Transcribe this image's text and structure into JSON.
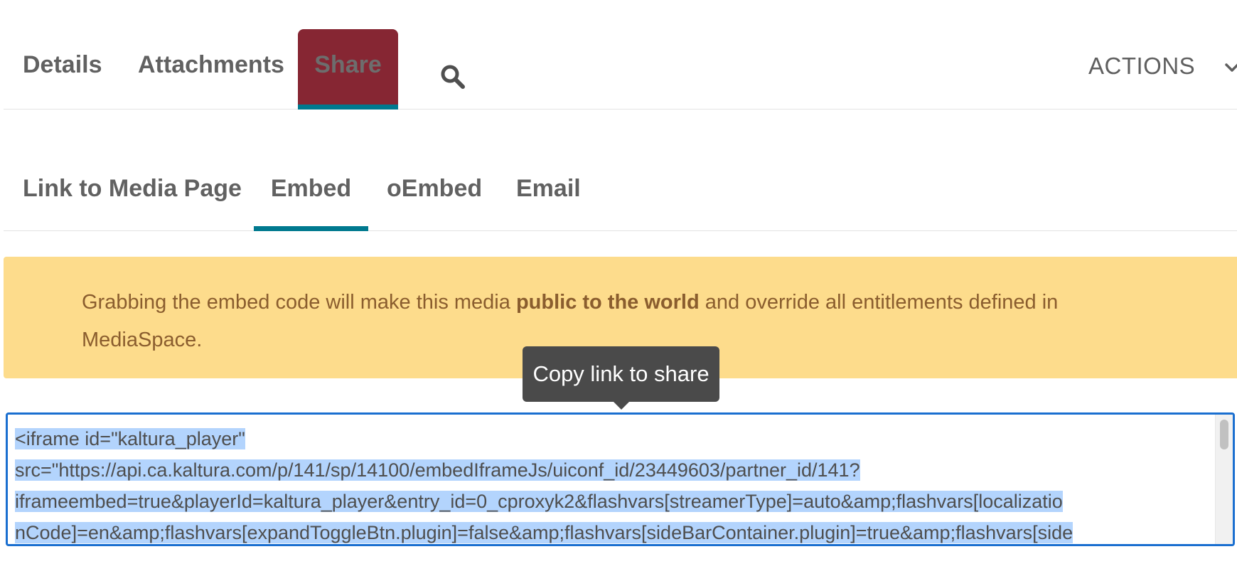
{
  "top_tabs": {
    "details": "Details",
    "attachments": "Attachments",
    "share": "Share",
    "search_icon": "search-icon",
    "actions": "ACTIONS",
    "actions_icon": "chevron-down-icon",
    "active": "Share"
  },
  "share_tabs": {
    "link_to_media_page": "Link to Media Page",
    "embed": "Embed",
    "oembed": "oEmbed",
    "email": "Email",
    "active": "Embed"
  },
  "warning": {
    "text_before": "Grabbing the embed code will make this media ",
    "text_bold": "public to the world",
    "text_after": " and override all entitlements defined in MediaSpace."
  },
  "tooltip": {
    "text": "Copy link to share"
  },
  "embed_code": {
    "lines": [
      "<iframe id=\"kaltura_player\"",
      "src=\"https://api.ca.kaltura.com/p/141/sp/14100/embedIframeJs/uiconf_id/23449603/partner_id/141?",
      "iframeembed=true&playerId=kaltura_player&entry_id=0_cproxyk2&flashvars[streamerType]=auto&amp;flashvars[localizatio",
      "nCode]=en&amp;flashvars[expandToggleBtn.plugin]=false&amp;flashvars[sideBarContainer.plugin]=true&amp;flashvars[side"
    ],
    "selected": true
  },
  "colors": {
    "share_tab_bg": "#862633",
    "accent_teal": "#00798f",
    "warning_bg": "#fddc8c",
    "warning_text": "#8a5d2e",
    "selection": "#b3d4fd",
    "focus_border": "#1a6fd0",
    "tooltip_bg": "#4a4a4a"
  }
}
